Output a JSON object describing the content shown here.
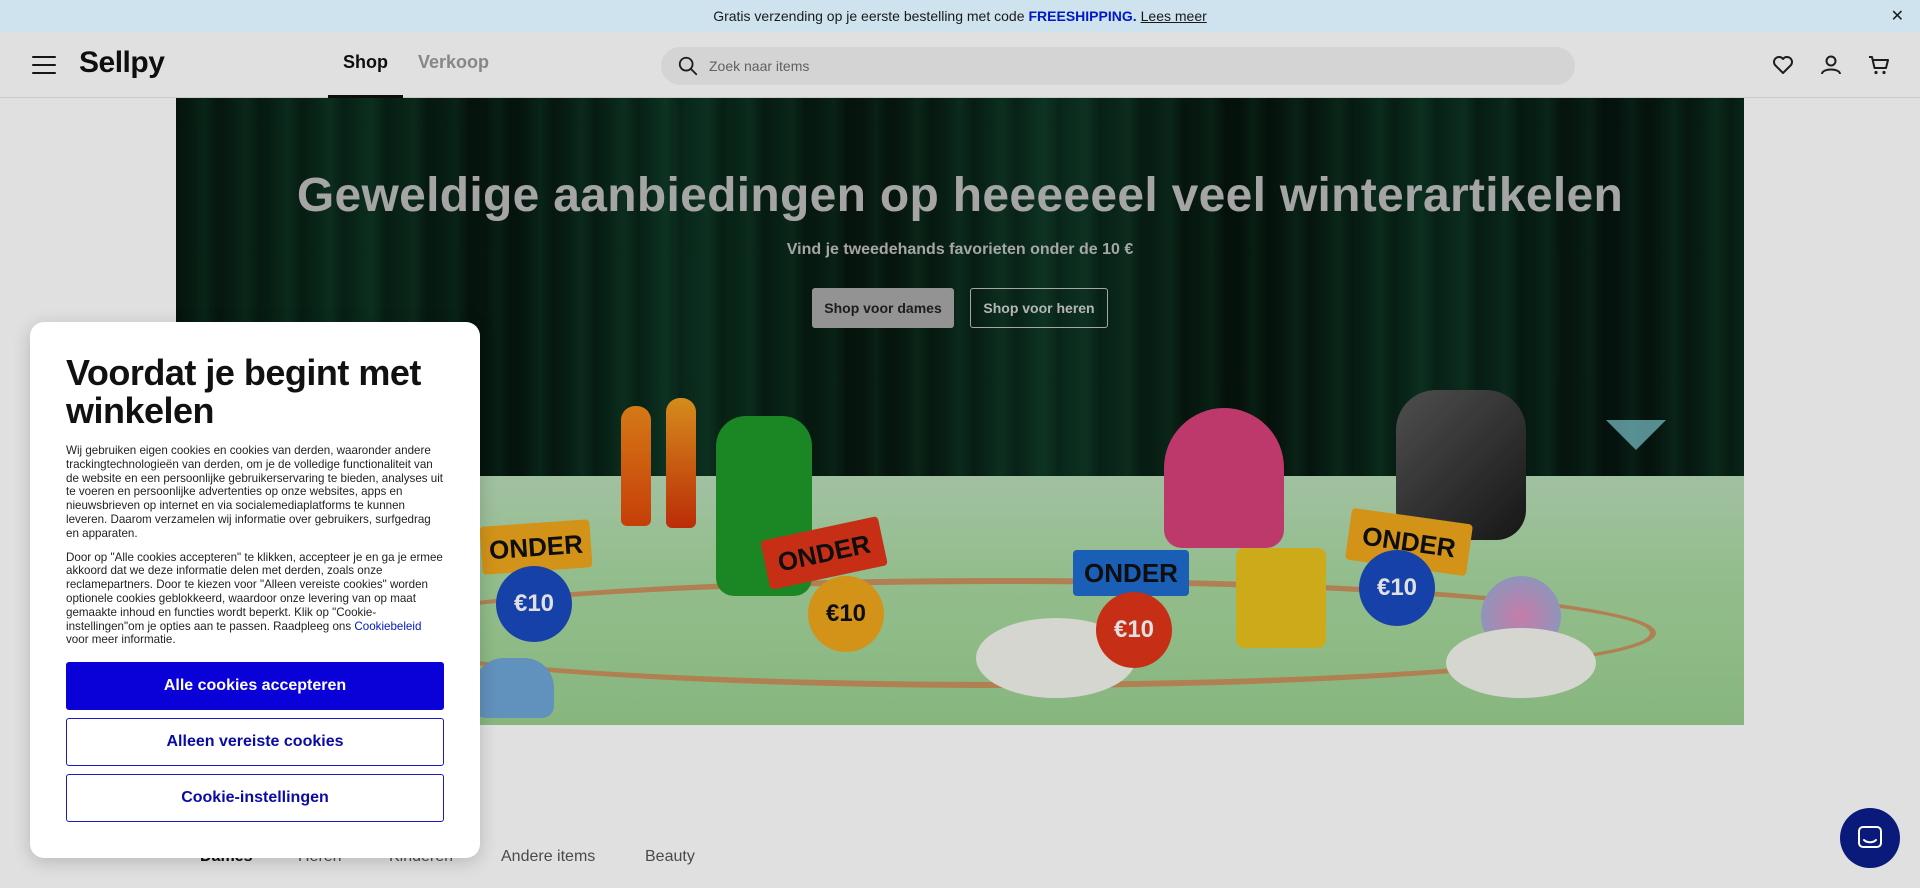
{
  "promo": {
    "text": "Gratis verzending op je eerste bestelling met code",
    "code": "FREESHIPPING.",
    "link": "Lees meer",
    "close_icon": "close-icon"
  },
  "header": {
    "logo": "Sellpy",
    "tabs": [
      {
        "label": "Shop",
        "active": true
      },
      {
        "label": "Verkoop",
        "active": false
      }
    ],
    "search_placeholder": "Zoek naar items",
    "icons": [
      "heart-icon",
      "user-icon",
      "cart-icon"
    ]
  },
  "hero": {
    "title": "Geweldige aanbiedingen op heeeeeel veel winterartikelen",
    "subtitle": "Vind je tweedehands favorieten onder de 10 €",
    "button_dames": "Shop voor dames",
    "button_heren": "Shop voor heren",
    "tag_onder": "ONDER",
    "tag_price": "€10"
  },
  "categories": [
    "Dames",
    "Heren",
    "Kinderen",
    "Andere items",
    "Beauty"
  ],
  "cookie": {
    "title": "Voordat je begint met winkelen",
    "para1": "Wij gebruiken eigen cookies en cookies van derden, waaronder andere trackingtechnologieën van derden, om je de volledige functionaliteit van de website en een persoonlijke gebruikerservaring te bieden, analyses uit te voeren en persoonlijke advertenties op onze websites, apps en nieuwsbrieven op internet en via socialemediaplatforms te kunnen leveren. Daarom verzamelen wij informatie over gebruikers, surfgedrag en apparaten.",
    "para2": "Door op \"Alle cookies accepteren\" te klikken, accepteer je en ga je ermee akkoord dat we deze informatie delen met derden, zoals onze reclamepartners. Door te kiezen voor \"Alleen vereiste cookies\" worden optionele cookies geblokkeerd, waardoor onze levering van op maat gemaakte inhoud en functies wordt beperkt. Klik op \"Cookie-instellingen\"om je opties aan te passen. Raadpleeg ons",
    "policy_link": "Cookiebeleid",
    "para2_end": "voor meer informatie.",
    "accept_all": "Alle cookies accepteren",
    "required_only": "Alleen vereiste cookies",
    "settings": "Cookie-instellingen"
  },
  "colors": {
    "promo_bg": "#cfe3ee",
    "accent": "#0a00d8",
    "chat": "#0a1a7a"
  }
}
